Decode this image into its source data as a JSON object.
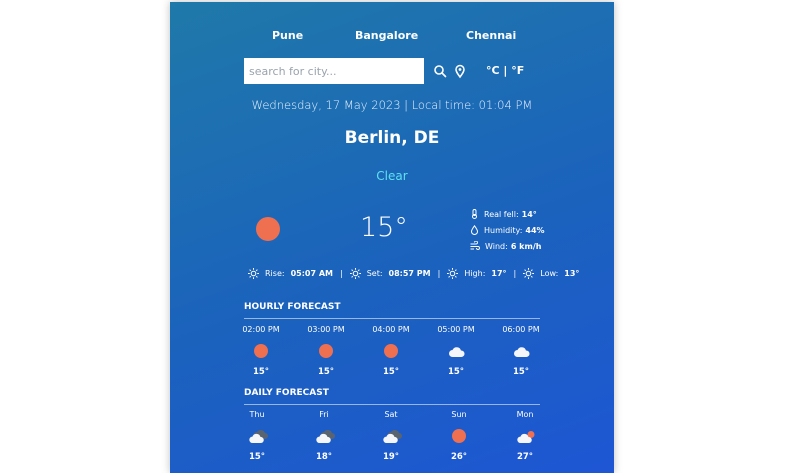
{
  "cities": [
    "Pune",
    "Bangalore",
    "Chennai"
  ],
  "search": {
    "placeholder": "search for city..."
  },
  "units": {
    "celsius": "°C",
    "separator": "|",
    "fahrenheit": "°F"
  },
  "datetime": "Wednesday, 17 May 2023 | Local time: 01:04 PM",
  "location": "Berlin, DE",
  "clear_label": "Clear",
  "current": {
    "temp": "15°",
    "icon": "sun-icon",
    "details": [
      {
        "icon": "thermometer-icon",
        "label": "Real fell:",
        "value": "14°"
      },
      {
        "icon": "droplet-icon",
        "label": "Humidity:",
        "value": "44%"
      },
      {
        "icon": "wind-icon",
        "label": "Wind:",
        "value": "6 km/h"
      }
    ]
  },
  "stats": [
    {
      "icon": "sunrise-icon",
      "label": "Rise:",
      "value": "05:07 AM"
    },
    {
      "icon": "sunset-icon",
      "label": "Set:",
      "value": "08:57 PM"
    },
    {
      "icon": "high-temp-icon",
      "label": "High:",
      "value": "17°"
    },
    {
      "icon": "low-temp-icon",
      "label": "Low:",
      "value": "13°"
    }
  ],
  "hourly": {
    "title": "HOURLY FORECAST",
    "items": [
      {
        "label": "02:00 PM",
        "icon": "sun-icon",
        "temp": "15°"
      },
      {
        "label": "03:00 PM",
        "icon": "sun-icon",
        "temp": "15°"
      },
      {
        "label": "04:00 PM",
        "icon": "sun-icon",
        "temp": "15°"
      },
      {
        "label": "05:00 PM",
        "icon": "cloud-icon",
        "temp": "15°"
      },
      {
        "label": "06:00 PM",
        "icon": "cloud-icon",
        "temp": "15°"
      }
    ]
  },
  "daily": {
    "title": "DAILY FORECAST",
    "items": [
      {
        "label": "Thu",
        "icon": "broken-clouds-icon",
        "temp": "15°"
      },
      {
        "label": "Fri",
        "icon": "broken-clouds-icon",
        "temp": "18°"
      },
      {
        "label": "Sat",
        "icon": "broken-clouds-icon",
        "temp": "19°"
      },
      {
        "label": "Sun",
        "icon": "sun-icon",
        "temp": "26°"
      },
      {
        "label": "Mon",
        "icon": "partly-cloudy-icon",
        "temp": "27°"
      }
    ]
  },
  "colors": {
    "panel_start": "#1f79a9",
    "panel_end": "#1e56d4",
    "sun": "#ef6f51",
    "clear": "#5ee1f1"
  }
}
